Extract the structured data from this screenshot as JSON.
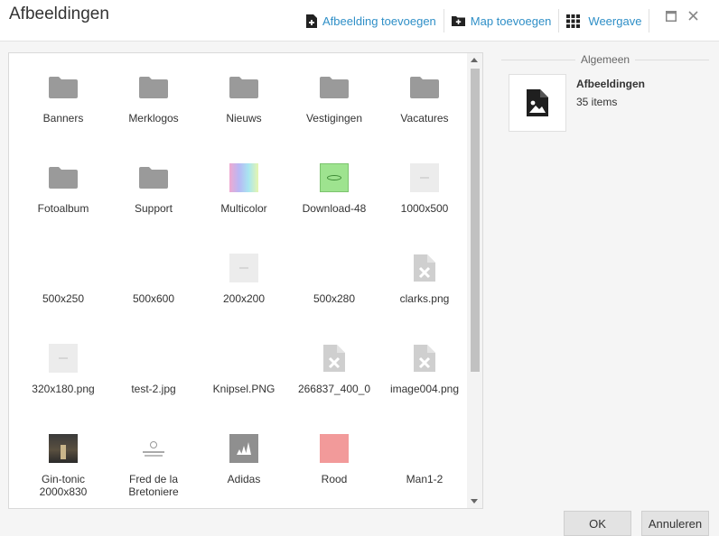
{
  "header": {
    "title": "Afbeeldingen",
    "add_image_label": "Afbeelding toevoegen",
    "add_folder_label": "Map toevoegen",
    "view_label": "Weergave"
  },
  "items": [
    {
      "name": "Banners",
      "kind": "folder"
    },
    {
      "name": "Merklogos",
      "kind": "folder"
    },
    {
      "name": "Nieuws",
      "kind": "folder"
    },
    {
      "name": "Vestigingen",
      "kind": "folder"
    },
    {
      "name": "Vacatures",
      "kind": "folder"
    },
    {
      "name": "Fotoalbum",
      "kind": "folder"
    },
    {
      "name": "Support",
      "kind": "folder"
    },
    {
      "name": "Multicolor",
      "kind": "gradient"
    },
    {
      "name": "Download-48",
      "kind": "green"
    },
    {
      "name": "1000x500",
      "kind": "placeholder"
    },
    {
      "name": "500x250",
      "kind": "none"
    },
    {
      "name": "500x600",
      "kind": "none"
    },
    {
      "name": "200x200",
      "kind": "placeholder"
    },
    {
      "name": "500x280",
      "kind": "none"
    },
    {
      "name": "clarks.png",
      "kind": "broken"
    },
    {
      "name": "320x180.png",
      "kind": "placeholder"
    },
    {
      "name": "test-2.jpg",
      "kind": "none"
    },
    {
      "name": "Knipsel.PNG",
      "kind": "none"
    },
    {
      "name": "266837_400_0",
      "kind": "broken"
    },
    {
      "name": "image004.png",
      "kind": "broken"
    },
    {
      "name": "Gin-tonic 2000x830",
      "kind": "photo-dark"
    },
    {
      "name": "Fred de la Bretoniere",
      "kind": "logo-fred"
    },
    {
      "name": "Adidas",
      "kind": "logo-adidas"
    },
    {
      "name": "Rood",
      "kind": "red"
    },
    {
      "name": "Man1-2",
      "kind": "none"
    }
  ],
  "info": {
    "legend": "Algemeen",
    "name": "Afbeeldingen",
    "count": "35 items"
  },
  "buttons": {
    "ok": "OK",
    "cancel": "Annuleren"
  }
}
